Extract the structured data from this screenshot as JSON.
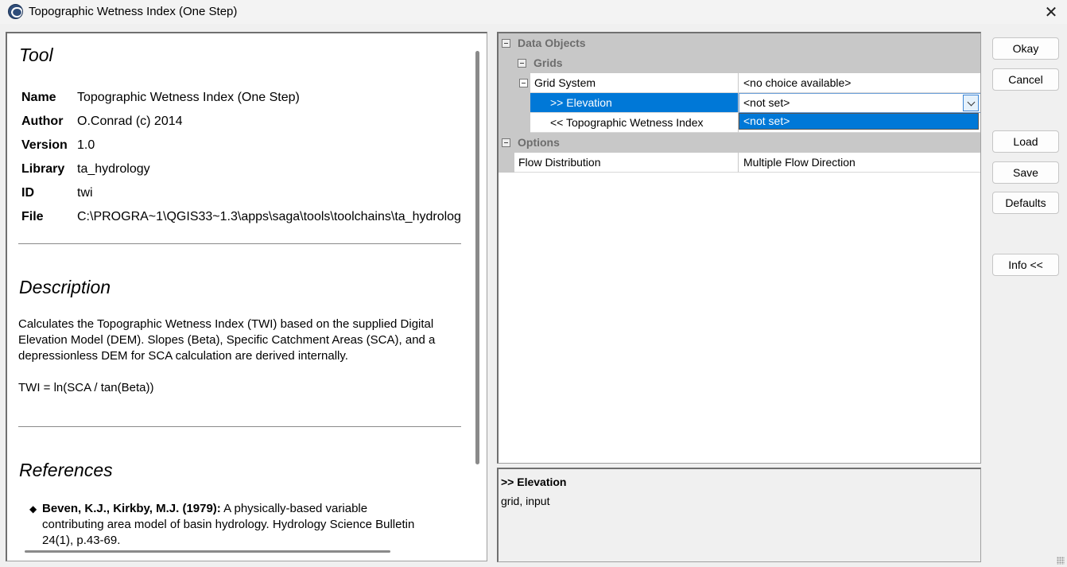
{
  "window": {
    "title": "Topographic Wetness Index (One Step)",
    "close_glyph": "✕",
    "app_icon": "saga-globe-icon"
  },
  "tool_doc": {
    "tool_heading": "Tool",
    "meta": [
      {
        "key": "Name",
        "value": "Topographic Wetness Index (One Step)"
      },
      {
        "key": "Author",
        "value": "O.Conrad (c) 2014"
      },
      {
        "key": "Version",
        "value": "1.0"
      },
      {
        "key": "Library",
        "value": "ta_hydrology"
      },
      {
        "key": "ID",
        "value": "twi"
      },
      {
        "key": "File",
        "value": "C:\\PROGRA~1\\QGIS33~1.3\\apps\\saga\\tools\\toolchains\\ta_hydrolog"
      }
    ],
    "description_heading": "Description",
    "description_text": "Calculates the Topographic Wetness Index (TWI) based on the supplied Digital Elevation Model (DEM). Slopes (Beta), Specific Catchment Areas (SCA), and a depressionless DEM for SCA calculation are derived internally.",
    "formula": "TWI = ln(SCA / tan(Beta))",
    "references_heading": "References",
    "reference_bold": "Beven, K.J., Kirkby, M.J. (1979):",
    "reference_rest": " A physically-based variable contributing area model of basin hydrology. Hydrology Science Bulletin 24(1), p.43-69."
  },
  "property_grid": {
    "data_objects": "Data Objects",
    "grids": "Grids",
    "grid_system_label": "Grid System",
    "grid_system_value": "<no choice available>",
    "elevation_label": ">> Elevation",
    "elevation_value": "<not set>",
    "dropdown_option": "<not set>",
    "twi_label": "<< Topographic Wetness Index",
    "options": "Options",
    "flow_label": "Flow Distribution",
    "flow_value": "Multiple Flow Direction"
  },
  "info": {
    "title": ">> Elevation",
    "body": "grid, input"
  },
  "buttons": {
    "okay": "Okay",
    "cancel": "Cancel",
    "load": "Load",
    "save": "Save",
    "defaults": "Defaults",
    "info": "Info <<"
  }
}
